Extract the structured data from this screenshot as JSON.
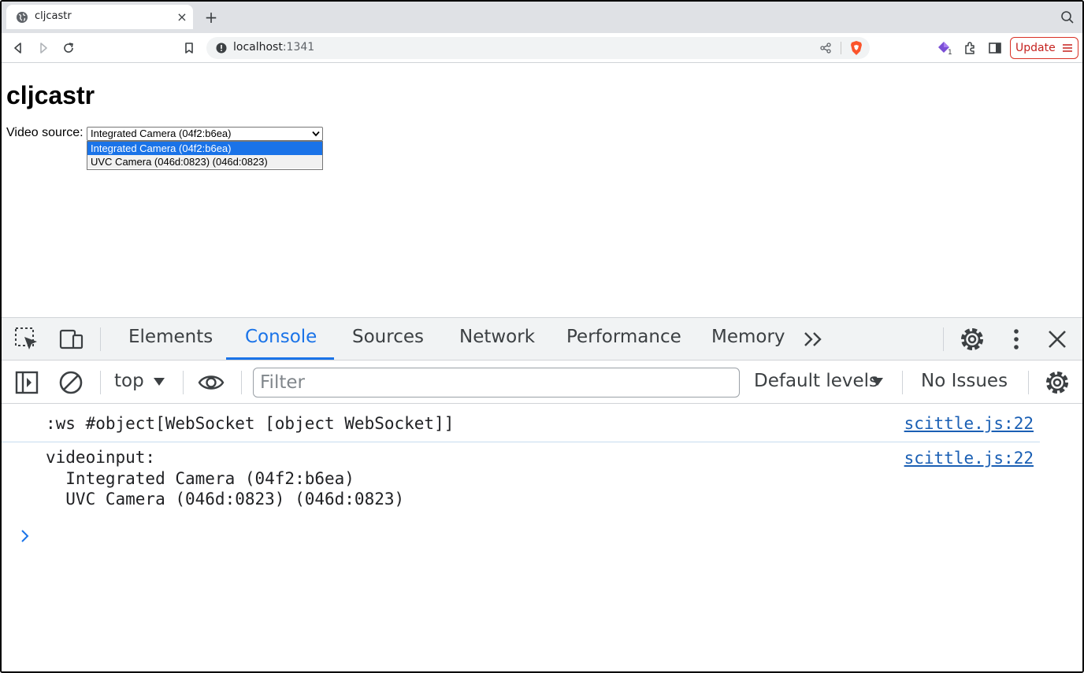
{
  "browser": {
    "tab_title": "cljcastr",
    "tab_close": "×",
    "new_tab": "+",
    "url_host": "localhost",
    "url_port": ":1341",
    "extension_badge": "1",
    "update_label": "Update"
  },
  "page": {
    "heading": "cljcastr",
    "video_source_label": "Video source:",
    "selected_source": "Integrated Camera (04f2:b6ea)",
    "options": [
      "Integrated Camera (04f2:b6ea)",
      "UVC Camera (046d:0823) (046d:0823)"
    ]
  },
  "devtools": {
    "tabs": [
      "Elements",
      "Console",
      "Sources",
      "Network",
      "Performance",
      "Memory"
    ],
    "active_tab": "Console",
    "more_tabs": "»",
    "context": "top",
    "filter_placeholder": "Filter",
    "default_levels": "Default levels",
    "issues": "No Issues"
  },
  "console": {
    "messages": [
      {
        "text": ":ws #object[WebSocket [object WebSocket]]",
        "source": "scittle.js:22"
      },
      {
        "text": "videoinput:\n  Integrated Camera (04f2:b6ea)\n  UVC Camera (046d:0823) (046d:0823)",
        "source": "scittle.js:22"
      }
    ]
  },
  "colors": {
    "accent": "#1a73e8",
    "link": "#1a5fb4",
    "update_red": "#d93025",
    "brave_orange": "#fb542b"
  }
}
